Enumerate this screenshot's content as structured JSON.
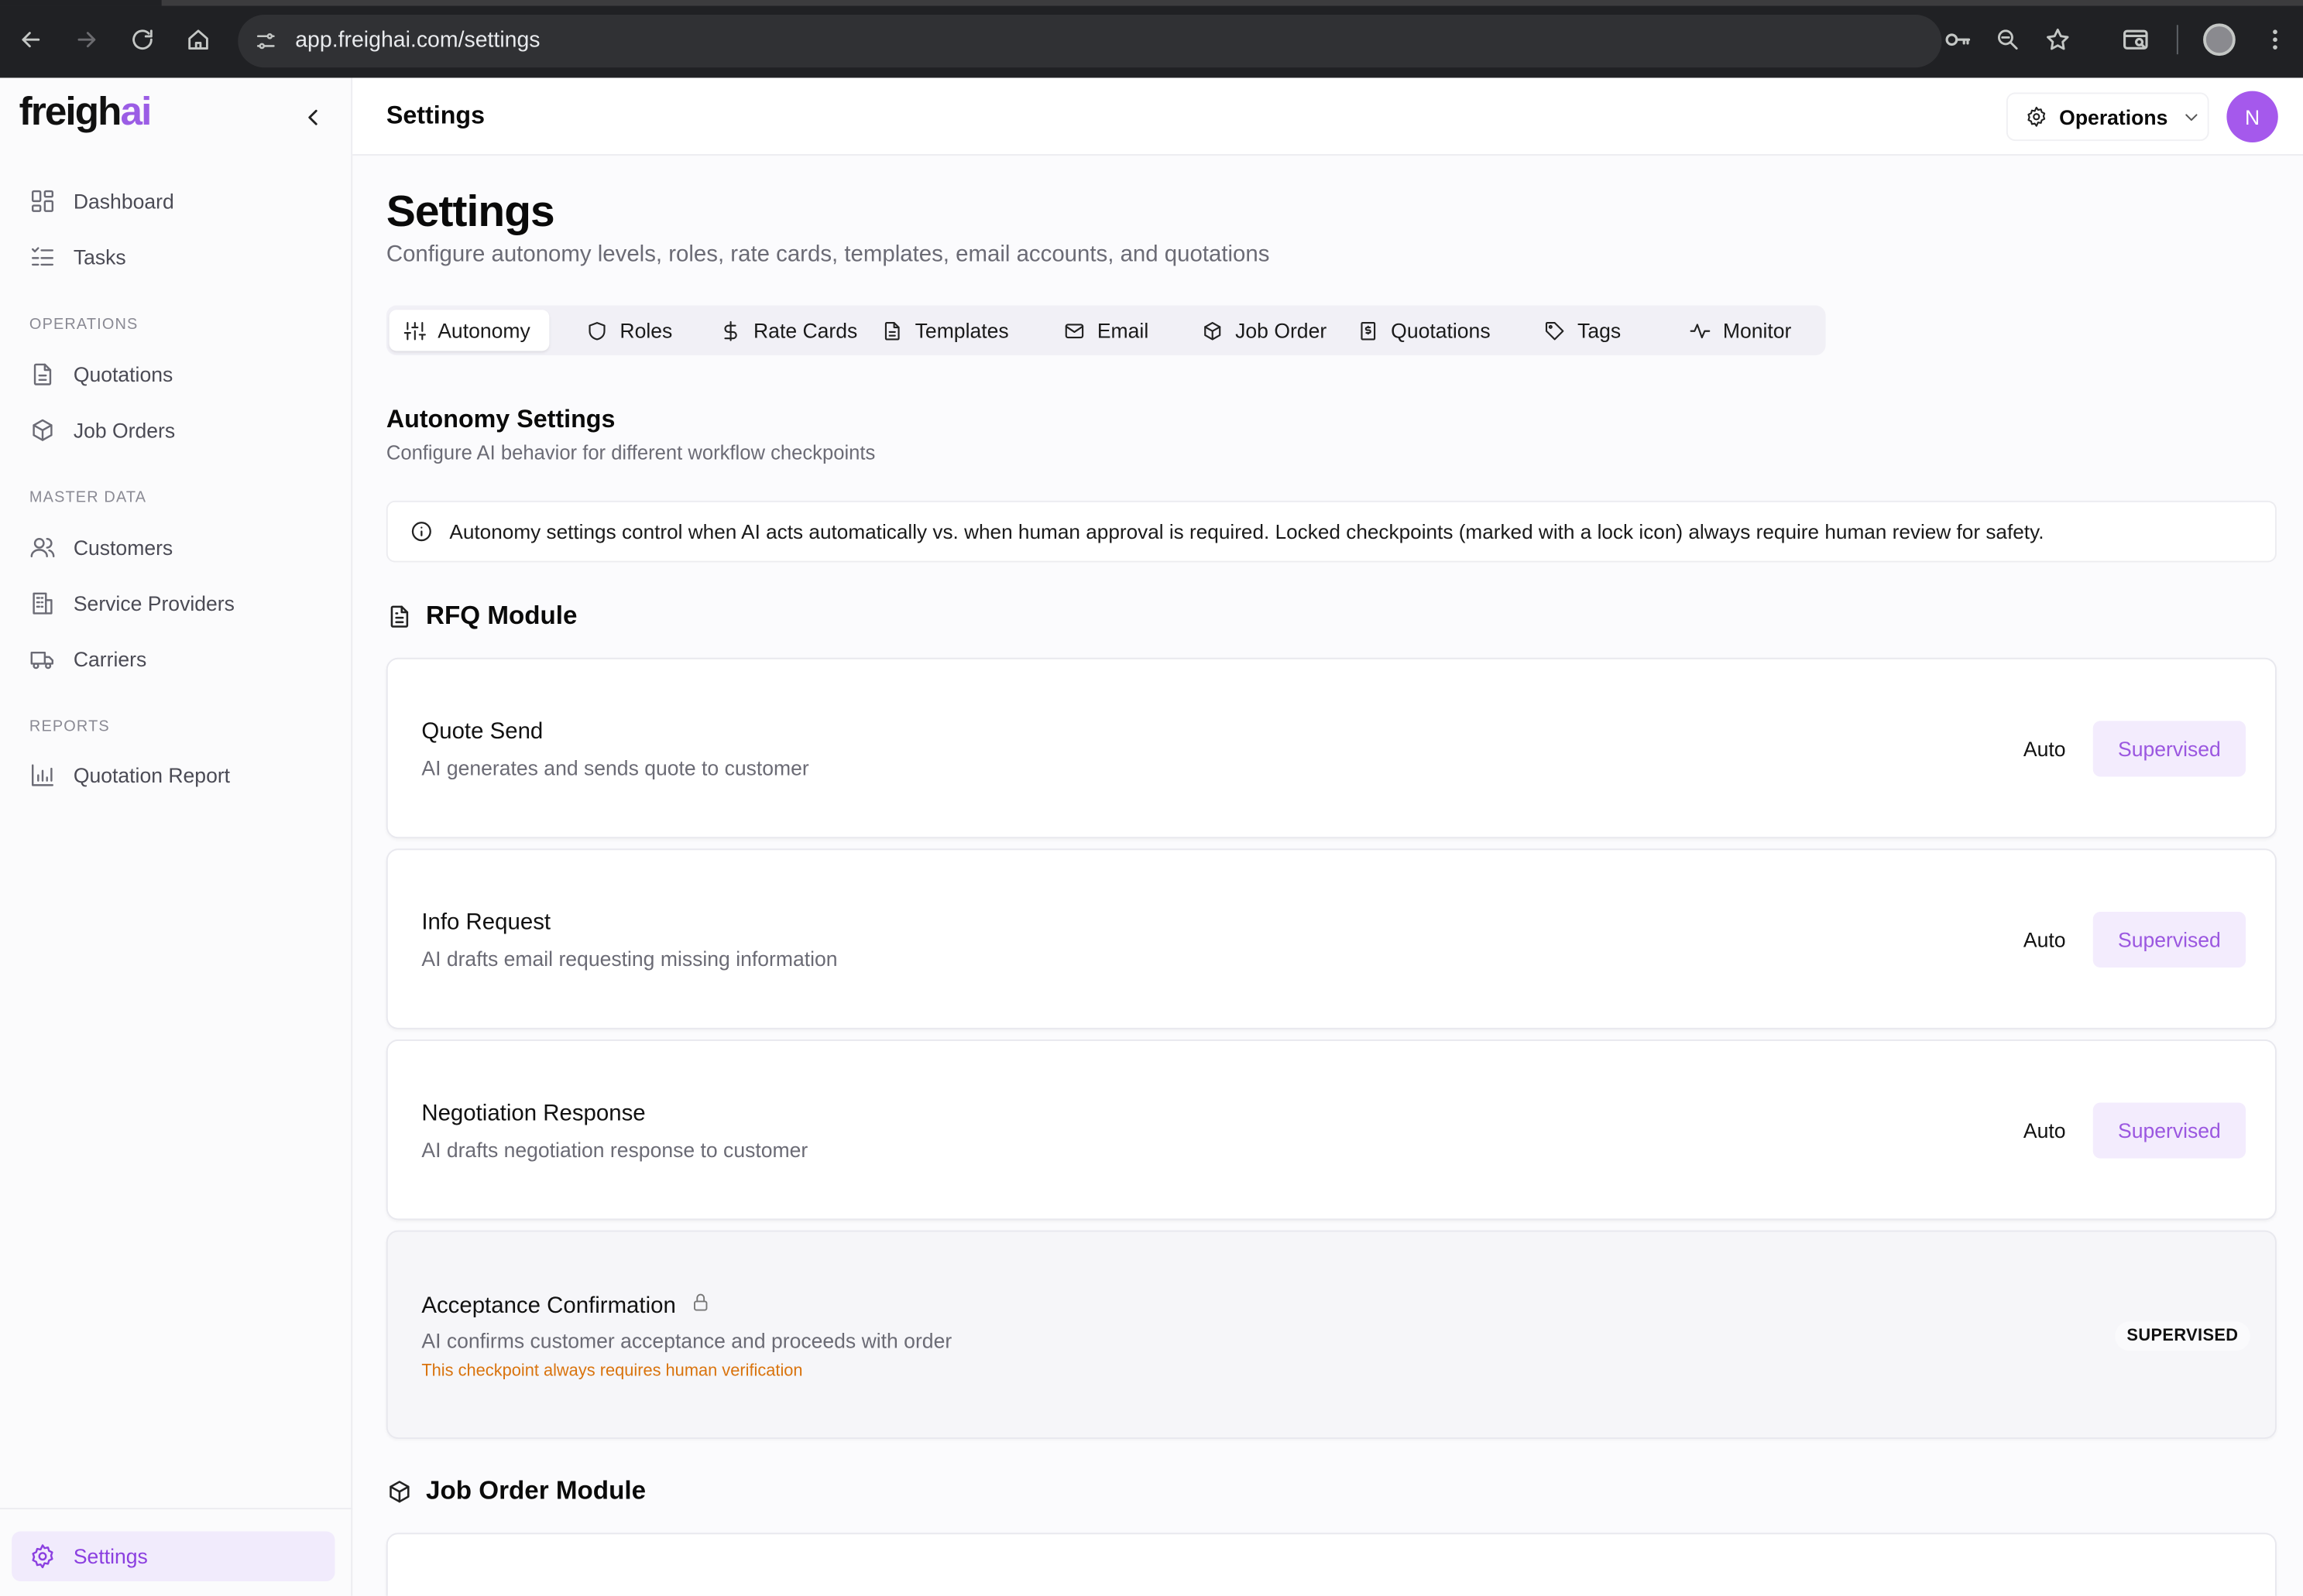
{
  "browser": {
    "url": "app.freighai.com/settings"
  },
  "sidebar": {
    "logo_main": "freigh",
    "logo_accent": "ai",
    "items_top": [
      {
        "label": "Dashboard",
        "icon": "dashboard-icon"
      },
      {
        "label": "Tasks",
        "icon": "tasks-icon"
      }
    ],
    "sections": [
      {
        "label": "OPERATIONS",
        "items": [
          {
            "label": "Quotations",
            "icon": "file-icon"
          },
          {
            "label": "Job Orders",
            "icon": "package-icon"
          }
        ]
      },
      {
        "label": "MASTER DATA",
        "items": [
          {
            "label": "Customers",
            "icon": "users-icon"
          },
          {
            "label": "Service Providers",
            "icon": "building-icon"
          },
          {
            "label": "Carriers",
            "icon": "truck-icon"
          }
        ]
      },
      {
        "label": "REPORTS",
        "items": [
          {
            "label": "Quotation Report",
            "icon": "bar-chart-icon"
          }
        ]
      }
    ],
    "settings_label": "Settings"
  },
  "header": {
    "title": "Settings",
    "role": "Operations",
    "avatar_initial": "N"
  },
  "page": {
    "title": "Settings",
    "subtitle": "Configure autonomy levels, roles, rate cards, templates, email accounts, and quotations"
  },
  "tabs": [
    {
      "label": "Autonomy",
      "icon": "sliders-icon",
      "active": true
    },
    {
      "label": "Roles",
      "icon": "shield-icon"
    },
    {
      "label": "Rate Cards",
      "icon": "dollar-icon"
    },
    {
      "label": "Templates",
      "icon": "file-icon"
    },
    {
      "label": "Email",
      "icon": "mail-icon"
    },
    {
      "label": "Job Order",
      "icon": "package-icon"
    },
    {
      "label": "Quotations",
      "icon": "receipt-icon"
    },
    {
      "label": "Tags",
      "icon": "tag-icon"
    },
    {
      "label": "Monitor",
      "icon": "activity-icon"
    }
  ],
  "autonomy": {
    "title": "Autonomy Settings",
    "subtitle": "Configure AI behavior for different workflow checkpoints",
    "info": "Autonomy settings control when AI acts automatically vs. when human approval is required. Locked checkpoints (marked with a lock icon) always require human review for safety."
  },
  "modules": [
    {
      "title": "RFQ Module",
      "checkpoints": [
        {
          "name": "Quote Send",
          "description": "AI generates and sends quote to customer",
          "auto_label": "Auto",
          "supervised_label": "Supervised",
          "selected": "Supervised"
        },
        {
          "name": "Info Request",
          "description": "AI drafts email requesting missing information",
          "auto_label": "Auto",
          "supervised_label": "Supervised",
          "selected": "Supervised"
        },
        {
          "name": "Negotiation Response",
          "description": "AI drafts negotiation response to customer",
          "auto_label": "Auto",
          "supervised_label": "Supervised",
          "selected": "Supervised"
        },
        {
          "name": "Acceptance Confirmation",
          "description": "AI confirms customer acceptance and proceeds with order",
          "locked": true,
          "note": "This checkpoint always requires human verification",
          "badge": "SUPERVISED"
        }
      ]
    },
    {
      "title": "Job Order Module"
    }
  ],
  "colors": {
    "accent": "#9b57e0",
    "accent_bg": "#f3ecfd",
    "warning": "#d9730d"
  }
}
